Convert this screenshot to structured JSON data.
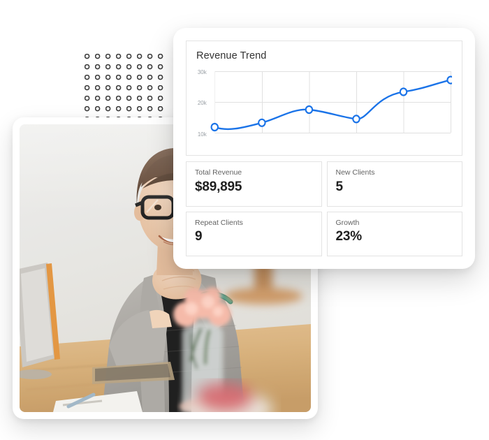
{
  "dashboard": {
    "chart_card": {
      "title": "Revenue Trend"
    },
    "stats": [
      {
        "label": "Total Revenue",
        "value": "$89,895",
        "name": "total-revenue"
      },
      {
        "label": "New Clients",
        "value": "5",
        "name": "new-clients"
      },
      {
        "label": "Repeat Clients",
        "value": "9",
        "name": "repeat-clients"
      },
      {
        "label": "Growth",
        "value": "23%",
        "name": "growth"
      }
    ]
  },
  "photo": {
    "alt": "Smiling woman with glasses resting chin on hands at a wooden cafe table with pastries and flowers"
  },
  "decor": {
    "dot_grid": {
      "icon": "dot-grid-pattern",
      "columns": 8,
      "rows": 7,
      "spacing": 15,
      "dot_color": "#3c3c3c"
    }
  },
  "colors": {
    "accent_blue": "#1a73e8",
    "grid_line": "#e0e0e0",
    "axis_label": "#9aa0a6",
    "card_border": "#e3e3e3",
    "value_text": "#1f1f1f",
    "label_text": "#636363"
  },
  "chart_data": {
    "type": "line",
    "title": "Revenue Trend",
    "xlabel": "",
    "ylabel": "",
    "ylim": [
      10000,
      30000
    ],
    "yticks": [
      10000,
      20000,
      30000
    ],
    "ytick_labels": [
      "10k",
      "20k",
      "30k"
    ],
    "grid": true,
    "legend": false,
    "x": [
      1,
      2,
      3,
      4,
      5,
      6
    ],
    "categories": [
      "1",
      "2",
      "3",
      "4",
      "5",
      "6"
    ],
    "series": [
      {
        "name": "Revenue",
        "color": "#1a73e8",
        "marker": "open-circle",
        "smooth": true,
        "values": [
          11800,
          13200,
          17500,
          15600,
          23500,
          27000
        ]
      }
    ]
  }
}
